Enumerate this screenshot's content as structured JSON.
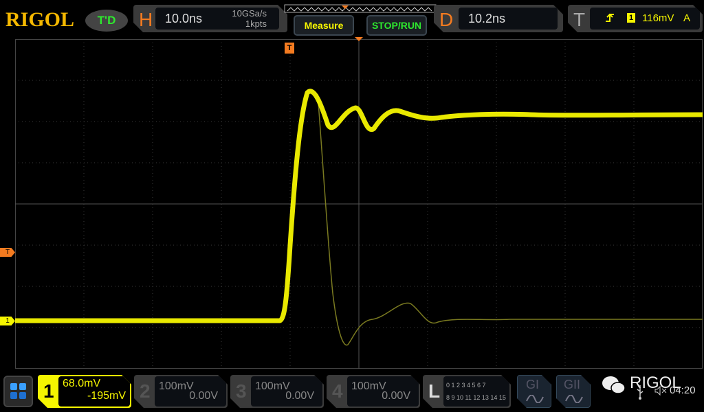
{
  "header": {
    "brand": "RIGOL",
    "mode_badge": "T'D",
    "horizontal": {
      "letter": "H",
      "timebase": "10.0ns",
      "sample_rate": "10GSa/s",
      "memory_depth": "1kpts"
    },
    "measure_label": "Measure",
    "stop_run_label": "STOP/RUN",
    "delay": {
      "letter": "D",
      "value": "10.2ns"
    },
    "trigger": {
      "letter": "T",
      "slope_icon": "rising-edge-icon",
      "source": "1",
      "level": "116mV",
      "mode": "A"
    }
  },
  "markers": {
    "trigger_level": "T",
    "channel1": "1",
    "trigger_position": "T"
  },
  "channels": [
    {
      "num": "1",
      "scale": "68.0mV",
      "offset": "-195mV",
      "active": true,
      "color": "#f5f500"
    },
    {
      "num": "2",
      "scale": "100mV",
      "offset": "0.00V",
      "active": false
    },
    {
      "num": "3",
      "scale": "100mV",
      "offset": "0.00V",
      "active": false
    },
    {
      "num": "4",
      "scale": "100mV",
      "offset": "0.00V",
      "active": false
    }
  ],
  "logic": {
    "letter": "L",
    "row1": "0 1 2 3  4 5 6 7",
    "row2": "8 9 10 11 12 13 14 15"
  },
  "generators": [
    {
      "label": "GI"
    },
    {
      "label": "GII"
    }
  ],
  "status": {
    "watermark": "RIGOL",
    "time": "04:20"
  },
  "colors": {
    "trace": "#f5f500",
    "accent": "#f47b20",
    "run": "#2ee82e"
  }
}
